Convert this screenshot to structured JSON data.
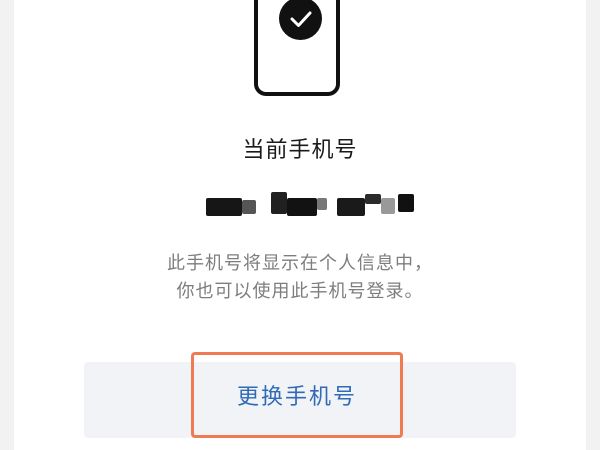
{
  "screen": {
    "title": "当前手机号",
    "description_line1": "此手机号将显示在个人信息中，",
    "description_line2": "你也可以使用此手机号登录。",
    "change_button_label": "更换手机号"
  },
  "colors": {
    "accent_text": "#2f6bb6",
    "highlight_border": "#f07a52",
    "muted_text": "#7d7d7d"
  },
  "icons": {
    "phone_illustration": "phone-icon",
    "check_badge": "check-circle-icon"
  }
}
